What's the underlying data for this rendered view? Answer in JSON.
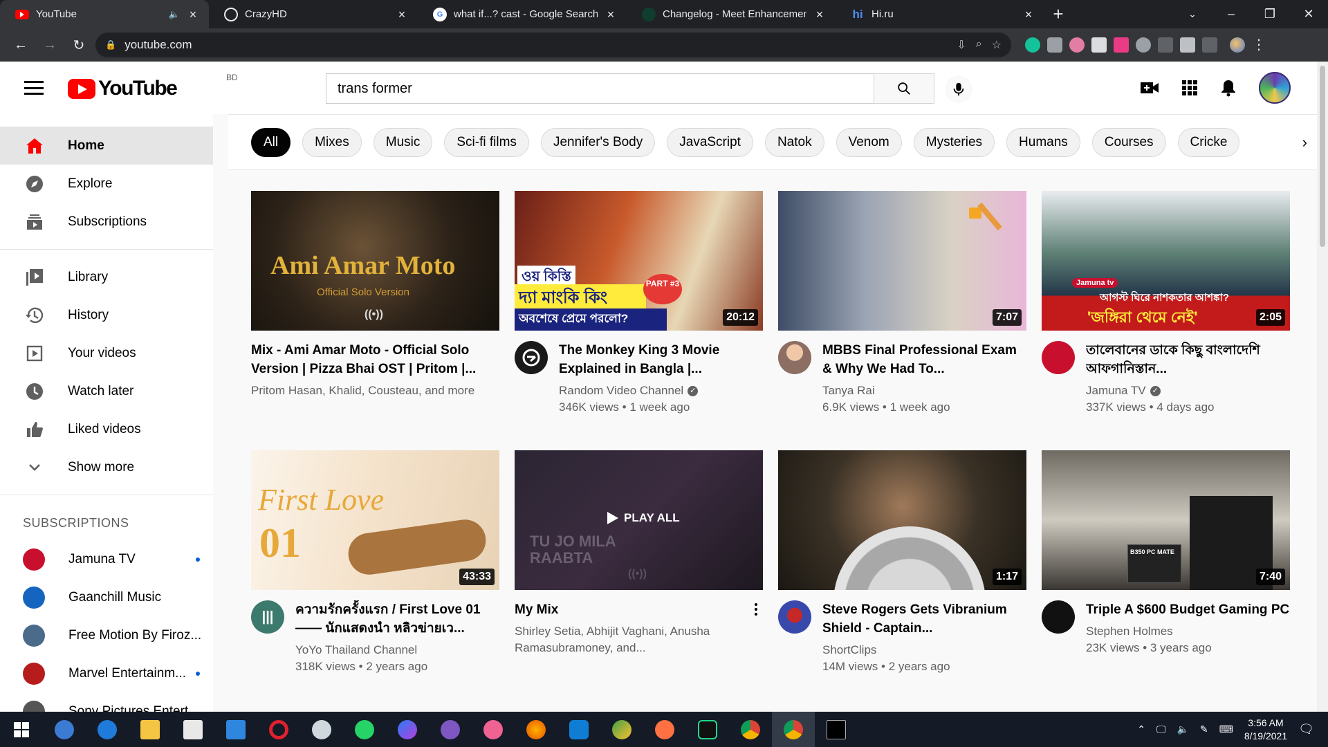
{
  "browser": {
    "tabs": [
      {
        "title": "YouTube",
        "active": true,
        "favicon": "youtube-icon"
      },
      {
        "title": "CrazyHD",
        "active": false,
        "favicon": "globe-icon"
      },
      {
        "title": "what if...? cast - Google Search",
        "active": false,
        "favicon": "google-icon"
      },
      {
        "title": "Changelog - Meet Enhancement",
        "active": false,
        "favicon": "meet-icon"
      },
      {
        "title": "Hi.ru",
        "active": false,
        "favicon": "hi-icon"
      }
    ],
    "url": "youtube.com"
  },
  "masthead": {
    "logo_text": "YouTube",
    "country_code": "BD",
    "search_value": "trans former",
    "search_placeholder": "Search"
  },
  "sidebar": {
    "main": [
      {
        "label": "Home",
        "icon": "home-icon",
        "active": true
      },
      {
        "label": "Explore",
        "icon": "compass-icon"
      },
      {
        "label": "Subscriptions",
        "icon": "subscriptions-icon"
      }
    ],
    "library": [
      {
        "label": "Library",
        "icon": "library-icon"
      },
      {
        "label": "History",
        "icon": "history-icon"
      },
      {
        "label": "Your videos",
        "icon": "your-videos-icon"
      },
      {
        "label": "Watch later",
        "icon": "clock-icon"
      },
      {
        "label": "Liked videos",
        "icon": "thumbs-up-icon"
      },
      {
        "label": "Show more",
        "icon": "chevron-down-icon"
      }
    ],
    "subscriptions_title": "SUBSCRIPTIONS",
    "subscriptions": [
      {
        "name": "Jamuna TV",
        "new": true,
        "color": "#c8102e"
      },
      {
        "name": "Gaanchill Music",
        "new": false,
        "color": "#1565c0"
      },
      {
        "name": "Free Motion By Firoz...",
        "new": false,
        "color": "#4a6b8a"
      },
      {
        "name": "Marvel Entertainm...",
        "new": true,
        "color": "#b71c1c"
      },
      {
        "name": "Sony Pictures Entert...",
        "new": false,
        "color": "#555555"
      }
    ]
  },
  "chips": [
    "All",
    "Mixes",
    "Music",
    "Sci-fi films",
    "Jennifer's Body",
    "JavaScript",
    "Natok",
    "Venom",
    "Mysteries",
    "Humans",
    "Courses",
    "Cricke"
  ],
  "videos": [
    {
      "title": "Mix - Ami Amar Moto - Official Solo Version | Pizza Bhai OST | Pritom |...",
      "channel": "Pritom Hasan, Khalid, Cousteau, and more",
      "stats": "",
      "duration": "",
      "verified": false,
      "is_mix": true,
      "thumb_text": "Ami Amar Moto",
      "thumb_sub": "Official Solo Version"
    },
    {
      "title": "The Monkey King 3 Movie Explained in Bangla |...",
      "channel": "Random Video Channel",
      "stats": "346K views • 1 week ago",
      "duration": "20:12",
      "verified": true,
      "avatar_color": "#1a1a1a",
      "thumb_text": "দ্যা মাংকি কিং",
      "thumb_sub": "অবশেষে প্রেমে পরলো?",
      "thumb_top": "ওয় কিস্তি",
      "thumb_badge": "PART #3"
    },
    {
      "title": "MBBS Final Professional Exam & Why We Had To...",
      "channel": "Tanya Rai",
      "stats": "6.9K views • 1 week ago",
      "duration": "7:07",
      "verified": false,
      "avatar_color": "#8d6e63"
    },
    {
      "title": "তালেবানের ডাকে কিছু বাংলাদেশি আফগানিস্তান...",
      "channel": "Jamuna TV",
      "stats": "337K views • 4 days ago",
      "duration": "2:05",
      "verified": true,
      "avatar_color": "#c8102e",
      "thumb_text": "'জঙ্গিরা থেমে নেই'",
      "thumb_sub": "আগস্ট ঘিরে নাশকতার আশঙ্কা?",
      "thumb_badge": "Jamuna tv"
    },
    {
      "title": "ความรักครั้งแรก / First Love 01 —— นักแสดงนำ หลิวข่ายเว...",
      "channel": "YoYo Thailand Channel",
      "stats": "318K views • 2 years ago",
      "duration": "43:33",
      "verified": false,
      "avatar_color": "#3d7a6e",
      "thumb_text": "First Love",
      "thumb_sub": "01"
    },
    {
      "title": "My Mix",
      "channel": "Shirley Setia, Abhijit Vaghani, Anusha Ramasubramoney, and...",
      "stats": "",
      "duration": "",
      "verified": false,
      "is_mix": true,
      "play_all": "PLAY ALL",
      "thumb_text": "TU JO MILA RAABTA"
    },
    {
      "title": "Steve Rogers Gets Vibranium Shield - Captain...",
      "channel": "ShortClips",
      "stats": "14M views • 2 years ago",
      "duration": "1:17",
      "verified": false,
      "avatar_color": "#3949ab"
    },
    {
      "title": "Triple A $600 Budget Gaming PC",
      "channel": "Stephen Holmes",
      "stats": "23K views • 3 years ago",
      "duration": "7:40",
      "verified": false,
      "avatar_color": "#111111",
      "thumb_text": "B350 PC MATE"
    }
  ],
  "taskbar": {
    "time": "3:56 AM",
    "date": "8/19/2021"
  }
}
